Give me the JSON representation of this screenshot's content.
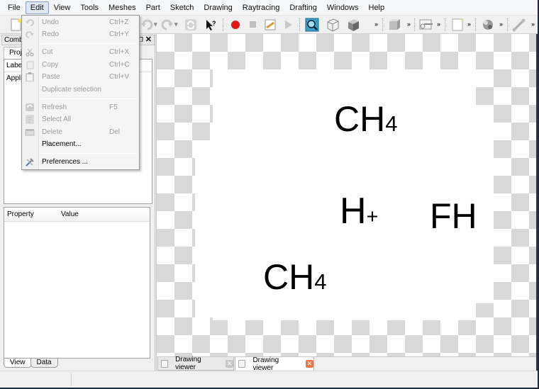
{
  "menubar": {
    "items": [
      "File",
      "Edit",
      "View",
      "Tools",
      "Meshes",
      "Part",
      "Sketch",
      "Drawing",
      "Raytracing",
      "Drafting",
      "Windows",
      "Help"
    ],
    "active": "Edit"
  },
  "toolbar": {
    "icons": [
      "new-document-icon",
      "undo-icon",
      "redo-icon",
      "refresh-icon",
      "whats-this-icon",
      "record-macro-icon",
      "stop-macro-icon",
      "edit-macro-icon",
      "run-macro-icon",
      "zoom-fit-icon",
      "wireframe-view-icon",
      "shaded-view-icon",
      "part-icon",
      "drawing-icon",
      "page-icon",
      "raytracing-icon",
      "tool-icon"
    ],
    "overflow": "»"
  },
  "edit_menu": {
    "items": [
      {
        "label": "Undo",
        "shortcut": "Ctrl+Z",
        "enabled": false,
        "icon": "undo-icon"
      },
      {
        "label": "Redo",
        "shortcut": "Ctrl+Y",
        "enabled": false,
        "icon": "redo-icon"
      },
      {
        "label": "Cut",
        "shortcut": "Ctrl+X",
        "enabled": false,
        "icon": "scissors-icon"
      },
      {
        "label": "Copy",
        "shortcut": "Ctrl+C",
        "enabled": false,
        "icon": "copy-icon"
      },
      {
        "label": "Paste",
        "shortcut": "Ctrl+V",
        "enabled": false,
        "icon": "clipboard-icon"
      },
      {
        "label": "Duplicate selection",
        "shortcut": "",
        "enabled": false,
        "icon": ""
      },
      {
        "label": "Refresh",
        "shortcut": "F5",
        "enabled": false,
        "icon": "refresh-icon"
      },
      {
        "label": "Select All",
        "shortcut": "",
        "enabled": false,
        "icon": "select-all-icon"
      },
      {
        "label": "Delete",
        "shortcut": "Del",
        "enabled": false,
        "icon": "delete-icon"
      },
      {
        "label": "Placement...",
        "shortcut": "",
        "enabled": true,
        "icon": ""
      },
      {
        "label": "Preferences ...",
        "shortcut": "",
        "enabled": true,
        "icon": "preferences-icon"
      }
    ]
  },
  "combo_view": {
    "title": "Combo View",
    "tab": "Project",
    "tree_header": "Labels & Attributes",
    "tree_rows": [
      "Application"
    ],
    "property_headers": [
      "Property",
      "Value"
    ],
    "bottom_tabs": [
      "View",
      "Data"
    ]
  },
  "document_tabs": [
    {
      "label": "Drawing viewer",
      "active": false
    },
    {
      "label": "Drawing viewer",
      "active": true
    }
  ],
  "drawing": {
    "labels": [
      {
        "main": "CH",
        "sub": "4"
      },
      {
        "main": "H",
        "sub": "+"
      },
      {
        "main": "FH",
        "sub": ""
      },
      {
        "main": "CH",
        "sub": "4"
      }
    ]
  },
  "colors": {
    "record": "#e01818",
    "close_active": "#e8784a",
    "close_inactive": "#c8c8c8"
  }
}
